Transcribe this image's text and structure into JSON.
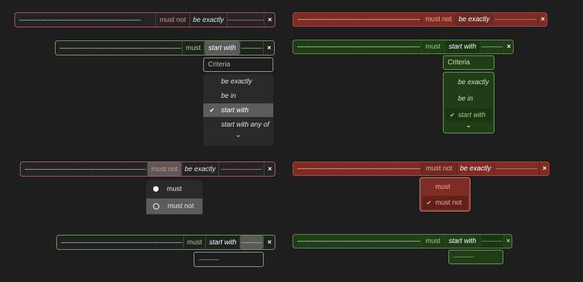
{
  "dash_long": "————————————————————————",
  "dash_mid": "——————",
  "dash_short": "———",
  "ops": {
    "must": "must",
    "must_not": "must not"
  },
  "comparators": {
    "be_exactly": "be exactly",
    "be_in": "be in",
    "start_with": "start with",
    "start_with_any_of": "start with any of"
  },
  "close": "×",
  "check": "✔",
  "chevron": "⌄",
  "search": {
    "placeholder": "Criteria"
  },
  "op_menu": {
    "must_icon": "check-circle-icon",
    "must_not_icon": "ban-icon"
  },
  "colors": {
    "background": "#1e1e1e",
    "red_border": "#b65a55",
    "red_fill": "#7d2d24",
    "green_border": "#6f9f5a",
    "green_fill": "#1f3e17",
    "must_not_text": "#f08b82",
    "must_text": "#9ed27f"
  },
  "menu_selected": "start with"
}
